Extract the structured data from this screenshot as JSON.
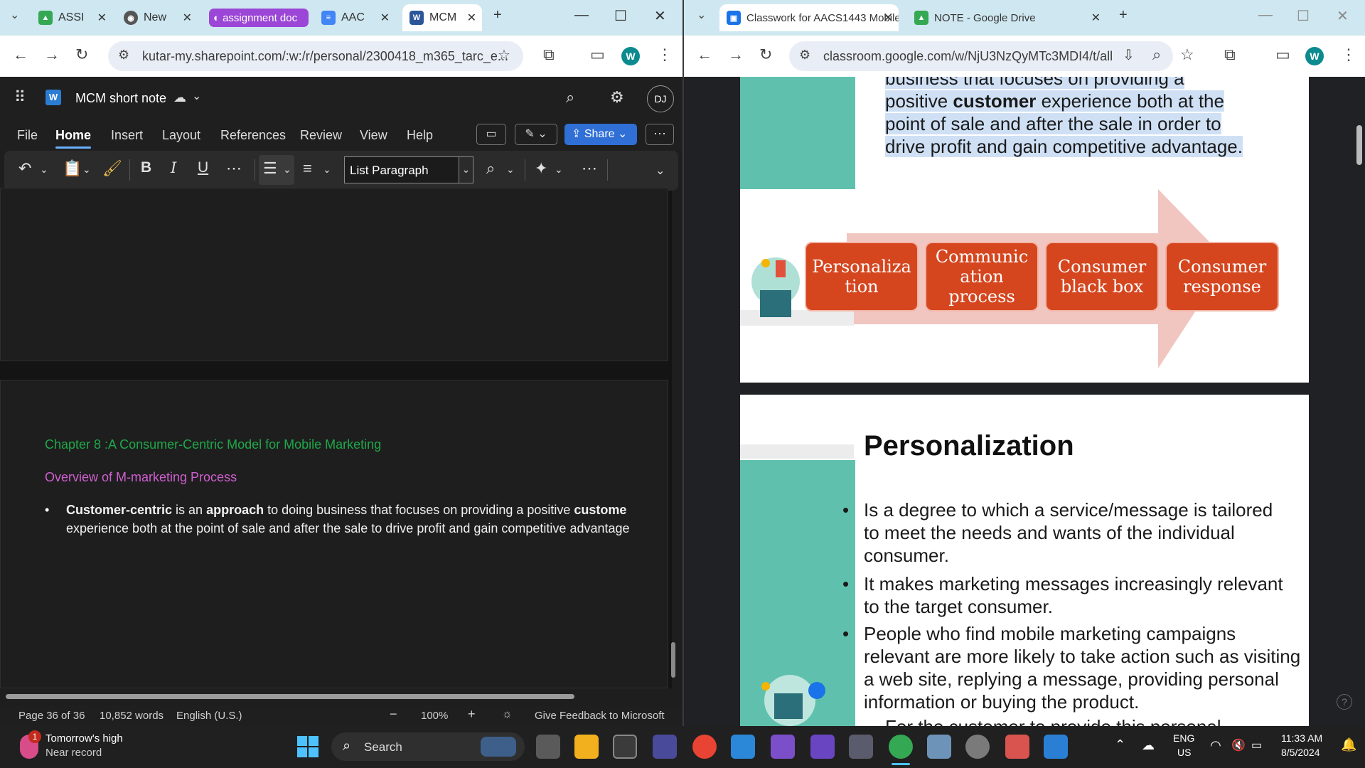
{
  "left_browser": {
    "tabs": [
      {
        "title": "ASSI",
        "icon": "google-drive-icon"
      },
      {
        "title": "New",
        "icon": "chrome-icon"
      },
      {
        "title": "assignment doc",
        "icon": "group-icon"
      },
      {
        "title": "AAC",
        "icon": "docs-icon"
      },
      {
        "title": "MCM",
        "icon": "word-icon"
      }
    ],
    "url": "kutar-my.sharepoint.com/:w:/r/personal/2300418_m365_tarc_e...",
    "profile_initial": "W"
  },
  "word": {
    "doc_title": "MCM short note",
    "user_initials": "DJ",
    "menu": [
      "File",
      "Home",
      "Insert",
      "Layout",
      "References",
      "Review",
      "View",
      "Help"
    ],
    "selected_menu": "Home",
    "share_label": "Share",
    "style_name": "List Paragraph",
    "heading1": "Chapter 8 :A Consumer-Centric Model for Mobile Marketing",
    "heading2": "Overview of M-marketing Process",
    "bullet_line1_parts": [
      "Customer-centric",
      " is an ",
      "approach",
      " to doing business that focuses on providing a positive ",
      "custome"
    ],
    "bullet_line2": "experience both at the point of sale and after the sale to drive profit and gain competitive advantage",
    "status": {
      "page": "Page 36 of 36",
      "words": "10,852 words",
      "language": "English (U.S.)",
      "zoom": "100%",
      "feedback": "Give Feedback to Microsoft"
    }
  },
  "right_browser": {
    "tabs": [
      {
        "title": "Classwork for AACS1443 Mobile",
        "icon": "classroom-icon"
      },
      {
        "title": "NOTE - Google Drive",
        "icon": "google-drive-icon"
      }
    ],
    "url": "classroom.google.com/w/NjU3NzQyMTc3MDI4/t/all",
    "profile_initial": "W"
  },
  "slides": {
    "slide1_text_lines": [
      "business that focuses on providing a",
      "positive customer experience both at the",
      "point of sale and after the sale in order to",
      "drive profit and gain competitive advantage."
    ],
    "process_boxes": [
      "Personalization",
      "Communication process",
      "Consumer black box",
      "Consumer response"
    ],
    "process_box_lines": [
      [
        "Personaliza",
        "tion"
      ],
      [
        "Communic",
        "ation",
        "process"
      ],
      [
        "Consumer",
        "black box"
      ],
      [
        "Consumer",
        "response"
      ]
    ],
    "slide2_title": "Personalization",
    "slide2_bullets": [
      "Is a degree to which a service/message is tailored to meet the needs and wants of the individual consumer.",
      "It makes marketing messages increasingly relevant to the target consumer.",
      "People who find mobile marketing campaigns relevant are more likely to take action such as visiting a web site, replying a message, providing personal information or buying the product."
    ],
    "slide2_cutoff": "For the customer to provide this personal"
  },
  "taskbar": {
    "weather_title": "Tomorrow's high",
    "weather_sub": "Near record",
    "weather_badge": "1",
    "search_label": "Search",
    "lang_top": "ENG",
    "lang_bottom": "US",
    "time": "11:33 AM",
    "date": "8/5/2024"
  },
  "colors": {
    "word_heading1": "#1fa84a",
    "word_heading2": "#d05fd0",
    "teal": "#5fc1ad",
    "process_orange": "#d5461f",
    "arrow_pink": "#f2c6c0",
    "share_blue": "#2f6fd6"
  }
}
